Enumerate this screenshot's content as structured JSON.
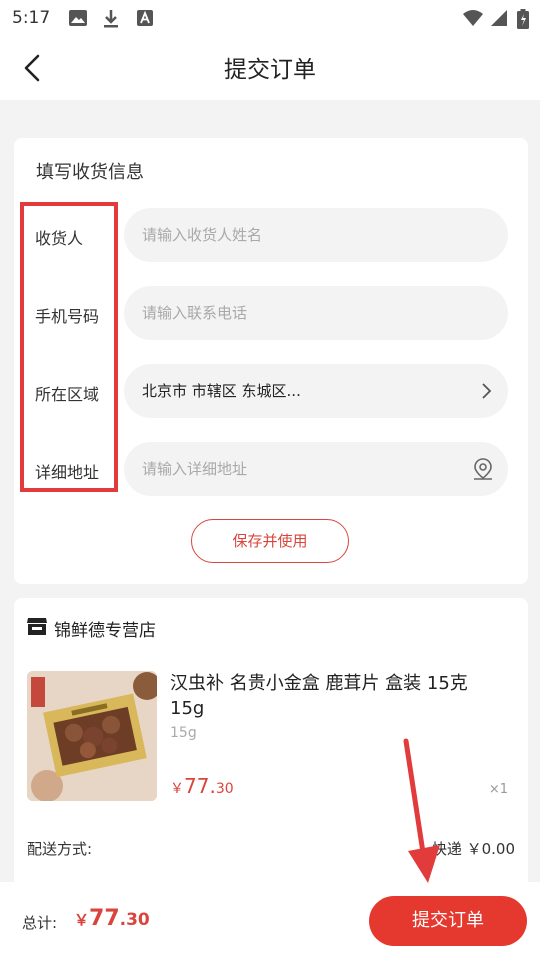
{
  "status_bar": {
    "time": "5:17"
  },
  "header": {
    "title": "提交订单"
  },
  "address_form": {
    "section_title": "填写收货信息",
    "fields": [
      {
        "label": "收货人",
        "placeholder": "请输入收货人姓名",
        "value": ""
      },
      {
        "label": "手机号码",
        "placeholder": "请输入联系电话",
        "value": ""
      },
      {
        "label": "所在区域",
        "placeholder": "",
        "value": "北京市 市辖区 东城区..."
      },
      {
        "label": "详细地址",
        "placeholder": "请输入详细地址",
        "value": ""
      }
    ],
    "save_button": "保存并使用"
  },
  "order": {
    "shop_name": "锦鲜德专营店",
    "product": {
      "title": "汉虫补 名贵小金盒 鹿茸片 盒装 15克 15g",
      "spec": "15g",
      "price_currency": "￥",
      "price_integer": "77.",
      "price_decimal": "30",
      "quantity": "×1"
    },
    "shipping_label": "配送方式:",
    "shipping_value": "快递 ￥0.00"
  },
  "footer": {
    "total_label": "总计:",
    "total_currency": "￥",
    "total_integer": "77",
    "total_decimal": ".30",
    "submit_button": "提交订单"
  },
  "colors": {
    "accent": "#e5382f",
    "annotation_red": "#e23b3b",
    "background": "#f3f3f3"
  }
}
